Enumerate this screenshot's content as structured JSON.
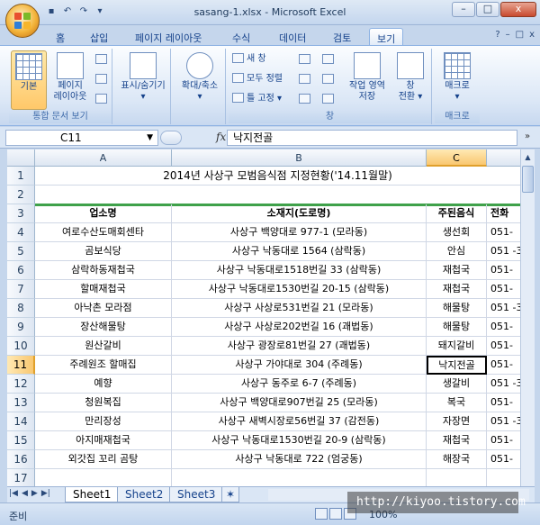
{
  "window": {
    "title": "sasang-1.xlsx - Microsoft Excel",
    "controls": [
      "–",
      "□",
      "x"
    ]
  },
  "ribbon_tabs": [
    "홈",
    "삽입",
    "페이지 레이아웃",
    "수식",
    "데이터",
    "검토",
    "보기"
  ],
  "active_tab": "보기",
  "ribbon": {
    "group1_label": "통합 문서 보기",
    "btn_normal": "기본",
    "btn_pagelayout_1": "페이지",
    "btn_pagelayout_2": "레이아웃",
    "btn_showhide_1": "표시/숨기기",
    "btn_zoom_1": "확대/축소",
    "btn_newwindow": "새 창",
    "btn_arrangeall": "모두 정렬",
    "btn_freeze": "틀 고정",
    "btn_workspace_1": "작업 영역",
    "btn_workspace_2": "저장",
    "btn_switch_1": "창",
    "btn_switch_2": "전환",
    "group_window_label": "창",
    "btn_macro": "매크로",
    "group_macro_label": "매크로"
  },
  "formula_bar": {
    "name_box": "C11",
    "fx": "fx",
    "value": "낙지전골"
  },
  "columns": [
    "A",
    "B",
    "C",
    "D"
  ],
  "active_column": "C",
  "active_row": "11",
  "title_row": "2014년 사상구 모범음식점 지정현황('14.11월말)",
  "headers": [
    "업소명",
    "소재지(도로명)",
    "주된음식",
    "전화"
  ],
  "rows": [
    {
      "n": "4",
      "a": "여로수산도매회센타",
      "b": "사상구 백양대로 977-1 (모라동)",
      "c": "생선회",
      "d": "051-"
    },
    {
      "n": "5",
      "a": "곰보식당",
      "b": "사상구 낙동대로 1564 (삼락동)",
      "c": "안심",
      "d": "051 -3"
    },
    {
      "n": "6",
      "a": "삼락하동재첩국",
      "b": "사상구 낙동대로1518번길 33 (삼락동)",
      "c": "재첩국",
      "d": "051-"
    },
    {
      "n": "7",
      "a": "할매재첩국",
      "b": "사상구 낙동대로1530번길 20-15 (삼락동)",
      "c": "재첩국",
      "d": "051-"
    },
    {
      "n": "8",
      "a": "아낙촌 모라점",
      "b": "사상구 사상로531번길 21 (모라동)",
      "c": "해물탕",
      "d": "051 -3"
    },
    {
      "n": "9",
      "a": "장산해물탕",
      "b": "사상구 사상로202번길 16 (괘법동)",
      "c": "해물탕",
      "d": "051-"
    },
    {
      "n": "10",
      "a": "원산갈비",
      "b": "사상구 광장로81번길 27 (괘법동)",
      "c": "돼지갈비",
      "d": "051-"
    },
    {
      "n": "11",
      "a": "주례원조 할매집",
      "b": "사상구 가야대로 304 (주례동)",
      "c": "낙지전골",
      "d": "051-"
    },
    {
      "n": "12",
      "a": "예향",
      "b": "사상구 동주로 6-7 (주례동)",
      "c": "생갈비",
      "d": "051 -3"
    },
    {
      "n": "13",
      "a": "청원복집",
      "b": "사상구 백양대로907번길 25 (모라동)",
      "c": "복국",
      "d": "051-"
    },
    {
      "n": "14",
      "a": "만리장성",
      "b": "사상구 새벽시장로56번길 37 (감전동)",
      "c": "자장면",
      "d": "051 -3"
    },
    {
      "n": "15",
      "a": "아지매재첩국",
      "b": "사상구 낙동대로1530번길 20-9 (삼락동)",
      "c": "재첩국",
      "d": "051-"
    },
    {
      "n": "16",
      "a": "외갓집 꼬리 곰탕",
      "b": "사상구 낙동대로 722 (엄궁동)",
      "c": "해장국",
      "d": "051-"
    },
    {
      "n": "17",
      "a": "",
      "b": "",
      "c": "",
      "d": ""
    }
  ],
  "row_numbers": [
    "1",
    "2",
    "3"
  ],
  "sheet_tabs": [
    "Sheet1",
    "Sheet2",
    "Sheet3"
  ],
  "active_sheet": "Sheet1",
  "status": {
    "text": "준비",
    "zoom": "100%"
  },
  "watermark": "http://kiyoo.tistory.com"
}
